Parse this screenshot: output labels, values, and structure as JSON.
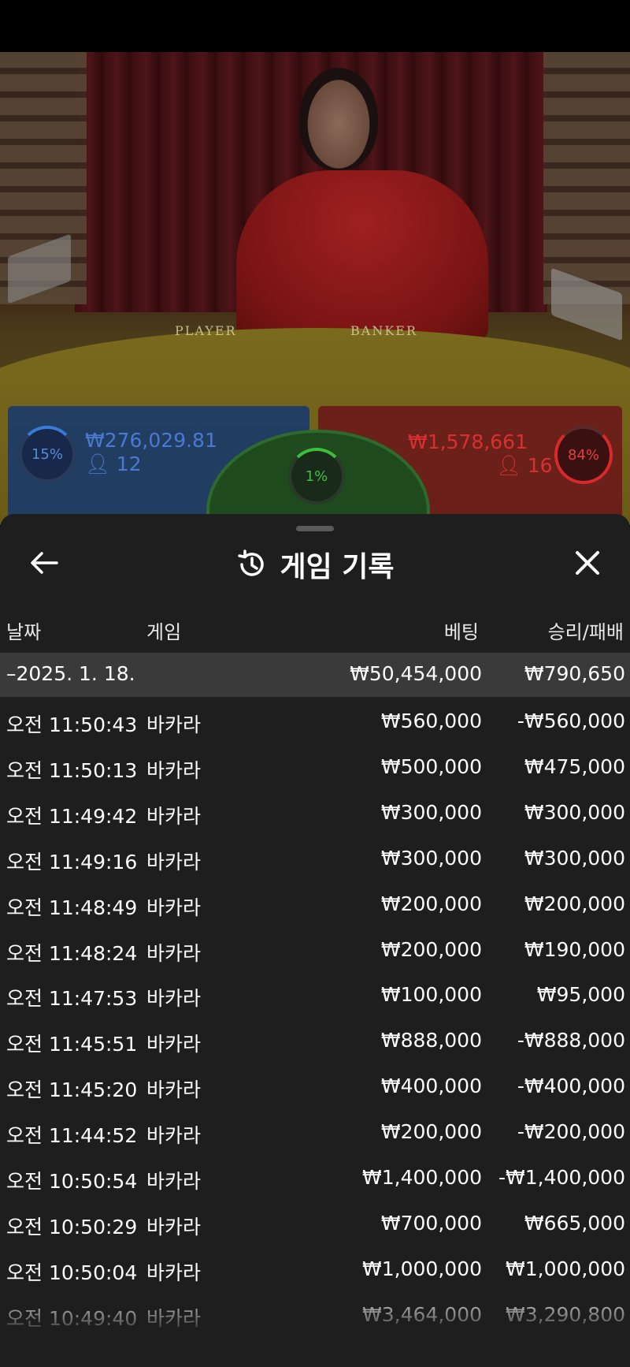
{
  "stream": {
    "table_labels": [
      "PLAYER",
      "BANKER"
    ],
    "player": {
      "percent": "15%",
      "amount": "₩276,029.81",
      "count": "12",
      "color": "#3a7ad8"
    },
    "tie": {
      "percent": "1%",
      "color": "#3ac03a"
    },
    "banker": {
      "percent": "84%",
      "amount": "₩1,578,661",
      "count": "16",
      "color": "#d82a2a"
    }
  },
  "sheet": {
    "title": "게임 기록",
    "icons": {
      "back": "arrow-left-icon",
      "history": "history-icon",
      "close": "close-icon"
    },
    "columns": {
      "date": "날짜",
      "game": "게임",
      "bet": "베팅",
      "result": "승리/패배"
    },
    "summary": {
      "date": "–2025. 1. 18.",
      "bet": "₩50,454,000",
      "result": "₩790,650"
    },
    "rows": [
      {
        "time": "오전 11:50:43",
        "game": "바카라",
        "bet": "₩560,000",
        "result": "-₩560,000"
      },
      {
        "time": "오전 11:50:13",
        "game": "바카라",
        "bet": "₩500,000",
        "result": "₩475,000"
      },
      {
        "time": "오전 11:49:42",
        "game": "바카라",
        "bet": "₩300,000",
        "result": "₩300,000"
      },
      {
        "time": "오전 11:49:16",
        "game": "바카라",
        "bet": "₩300,000",
        "result": "₩300,000"
      },
      {
        "time": "오전 11:48:49",
        "game": "바카라",
        "bet": "₩200,000",
        "result": "₩200,000"
      },
      {
        "time": "오전 11:48:24",
        "game": "바카라",
        "bet": "₩200,000",
        "result": "₩190,000"
      },
      {
        "time": "오전 11:47:53",
        "game": "바카라",
        "bet": "₩100,000",
        "result": "₩95,000"
      },
      {
        "time": "오전 11:45:51",
        "game": "바카라",
        "bet": "₩888,000",
        "result": "-₩888,000"
      },
      {
        "time": "오전 11:45:20",
        "game": "바카라",
        "bet": "₩400,000",
        "result": "-₩400,000"
      },
      {
        "time": "오전 11:44:52",
        "game": "바카라",
        "bet": "₩200,000",
        "result": "-₩200,000"
      },
      {
        "time": "오전 10:50:54",
        "game": "바카라",
        "bet": "₩1,400,000",
        "result": "-₩1,400,000"
      },
      {
        "time": "오전 10:50:29",
        "game": "바카라",
        "bet": "₩700,000",
        "result": "₩665,000"
      },
      {
        "time": "오전 10:50:04",
        "game": "바카라",
        "bet": "₩1,000,000",
        "result": "₩1,000,000"
      },
      {
        "time": "오전 10:49:40",
        "game": "바카라",
        "bet": "₩3,464,000",
        "result": "₩3,290,800"
      }
    ]
  }
}
